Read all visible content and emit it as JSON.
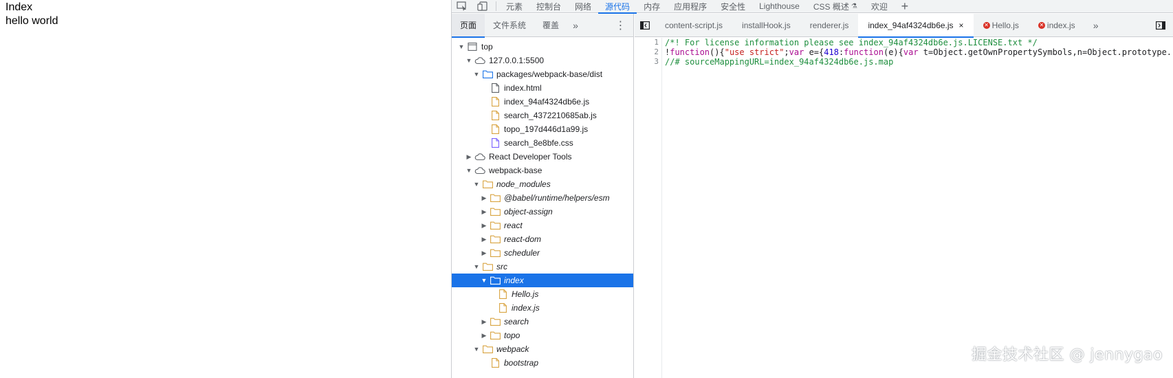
{
  "page": {
    "heading": "Index",
    "text": "hello world"
  },
  "devtools": {
    "main_tabs": [
      {
        "label": "元素"
      },
      {
        "label": "控制台"
      },
      {
        "label": "网络"
      },
      {
        "label": "源代码",
        "active": true
      },
      {
        "label": "内存"
      },
      {
        "label": "应用程序"
      },
      {
        "label": "安全性"
      },
      {
        "label": "Lighthouse"
      },
      {
        "label": "CSS 概述"
      },
      {
        "label": "欢迎"
      }
    ],
    "navigator": {
      "tabs": [
        {
          "label": "页面",
          "active": true
        },
        {
          "label": "文件系统"
        },
        {
          "label": "覆盖"
        }
      ],
      "tree": [
        {
          "label": "top",
          "depth": 0,
          "arrow": "down",
          "icon": "frame-icon"
        },
        {
          "label": "127.0.0.1:5500",
          "depth": 1,
          "arrow": "down",
          "icon": "cloud-icon"
        },
        {
          "label": "packages/webpack-base/dist",
          "depth": 2,
          "arrow": "down",
          "icon": "folder-blue-icon"
        },
        {
          "label": "index.html",
          "depth": 3,
          "arrow": "none",
          "icon": "file-html-icon"
        },
        {
          "label": "index_94af4324db6e.js",
          "depth": 3,
          "arrow": "none",
          "icon": "file-js-icon"
        },
        {
          "label": "search_4372210685ab.js",
          "depth": 3,
          "arrow": "none",
          "icon": "file-js-icon"
        },
        {
          "label": "topo_197d446d1a99.js",
          "depth": 3,
          "arrow": "none",
          "icon": "file-js-icon"
        },
        {
          "label": "search_8e8bfe.css",
          "depth": 3,
          "arrow": "none",
          "icon": "file-css-icon"
        },
        {
          "label": "React Developer Tools",
          "depth": 1,
          "arrow": "right",
          "icon": "cloud-icon"
        },
        {
          "label": "webpack-base",
          "depth": 1,
          "arrow": "down",
          "icon": "cloud-icon"
        },
        {
          "label": "node_modules",
          "depth": 2,
          "arrow": "down",
          "icon": "folder-icon",
          "italic": true
        },
        {
          "label": "@babel/runtime/helpers/esm",
          "depth": 3,
          "arrow": "right",
          "icon": "folder-icon",
          "italic": true
        },
        {
          "label": "object-assign",
          "depth": 3,
          "arrow": "right",
          "icon": "folder-icon",
          "italic": true
        },
        {
          "label": "react",
          "depth": 3,
          "arrow": "right",
          "icon": "folder-icon",
          "italic": true
        },
        {
          "label": "react-dom",
          "depth": 3,
          "arrow": "right",
          "icon": "folder-icon",
          "italic": true
        },
        {
          "label": "scheduler",
          "depth": 3,
          "arrow": "right",
          "icon": "folder-icon",
          "italic": true
        },
        {
          "label": "src",
          "depth": 2,
          "arrow": "down",
          "icon": "folder-icon",
          "italic": true
        },
        {
          "label": "index",
          "depth": 3,
          "arrow": "down",
          "icon": "folder-icon",
          "italic": true,
          "selected": true
        },
        {
          "label": "Hello.js",
          "depth": 4,
          "arrow": "none",
          "icon": "file-js-icon",
          "italic": true
        },
        {
          "label": "index.js",
          "depth": 4,
          "arrow": "none",
          "icon": "file-js-icon",
          "italic": true
        },
        {
          "label": "search",
          "depth": 3,
          "arrow": "right",
          "icon": "folder-icon",
          "italic": true
        },
        {
          "label": "topo",
          "depth": 3,
          "arrow": "right",
          "icon": "folder-icon",
          "italic": true
        },
        {
          "label": "webpack",
          "depth": 2,
          "arrow": "down",
          "icon": "folder-icon",
          "italic": true
        },
        {
          "label": "bootstrap",
          "depth": 3,
          "arrow": "none",
          "icon": "file-js-icon",
          "italic": true
        }
      ]
    },
    "editor": {
      "tabs": [
        {
          "label": "content-script.js"
        },
        {
          "label": "installHook.js"
        },
        {
          "label": "renderer.js"
        },
        {
          "label": "index_94af4324db6e.js",
          "active": true,
          "closable": true
        },
        {
          "label": "Hello.js",
          "error": true
        },
        {
          "label": "index.js",
          "error": true
        }
      ],
      "line_numbers": [
        "1",
        "2",
        "3"
      ],
      "lines": [
        [
          {
            "t": "/*! For license information please see index_94af4324db6e.js.LICENSE.txt */",
            "c": "comment"
          }
        ],
        [
          {
            "t": "!",
            "c": ""
          },
          {
            "t": "function",
            "c": "kw"
          },
          {
            "t": "(){",
            "c": ""
          },
          {
            "t": "\"use strict\"",
            "c": "str"
          },
          {
            "t": ";",
            "c": ""
          },
          {
            "t": "var",
            "c": "kw"
          },
          {
            "t": " e={",
            "c": ""
          },
          {
            "t": "418",
            "c": "num"
          },
          {
            "t": ":",
            "c": ""
          },
          {
            "t": "function",
            "c": "kw"
          },
          {
            "t": "(e){",
            "c": ""
          },
          {
            "t": "var",
            "c": "kw"
          },
          {
            "t": " t=Object.getOwnPropertySymbols,n=Object.prototype.",
            "c": ""
          }
        ],
        [
          {
            "t": "//# sourceMappingURL=index_94af4324db6e.js.map",
            "c": "comment"
          }
        ]
      ]
    },
    "colors": {
      "accent": "#1a73e8",
      "folder": "#d9a441",
      "folder_blue": "#1a73e8",
      "comment": "#1e8e3e",
      "keyword": "#aa0d91",
      "string": "#c5221f",
      "number": "#1c00cf",
      "error": "#d93025"
    }
  },
  "watermark": "掘金技术社区 @ jennygao"
}
